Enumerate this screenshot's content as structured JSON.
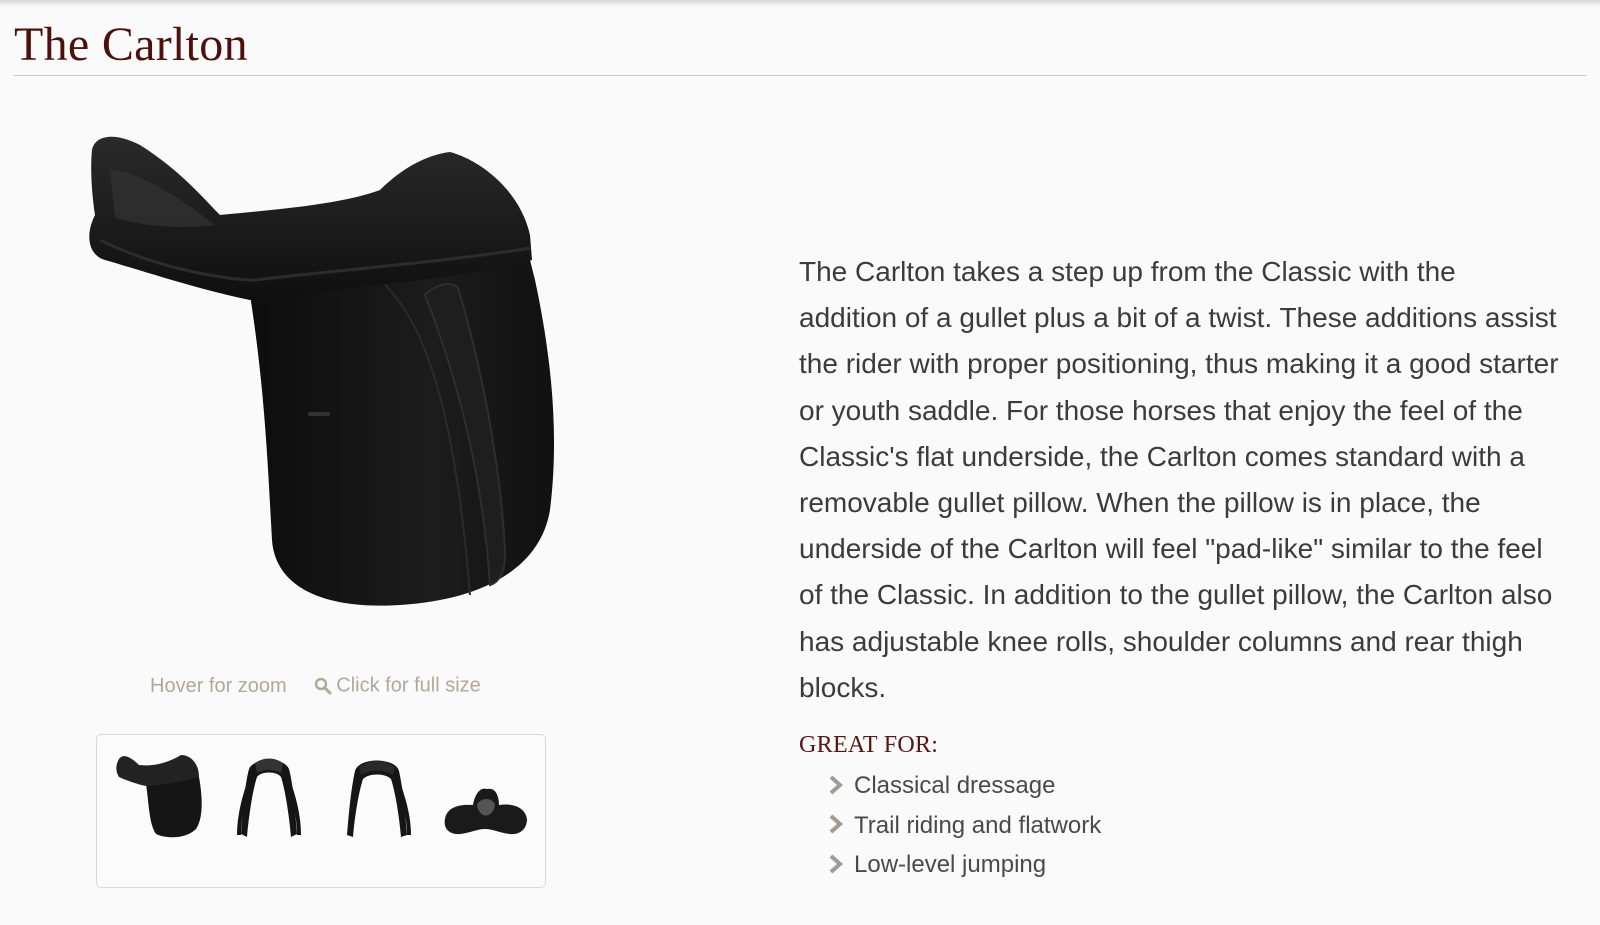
{
  "page": {
    "title": "The Carlton"
  },
  "gallery": {
    "hover_hint": "Hover for zoom",
    "full_size_label": "Click for full size",
    "thumbnails": [
      {
        "icon": "saddle-side-view"
      },
      {
        "icon": "saddle-front-view"
      },
      {
        "icon": "saddle-rear-view"
      },
      {
        "icon": "saddle-underside-view"
      }
    ]
  },
  "description": " The Carlton takes a step up from the Classic with the addition of a gullet plus a bit of a twist. These additions assist the rider with proper positioning, thus making it a good starter or youth saddle. For those horses that enjoy the feel of the Classic's flat underside, the Carlton comes standard with a removable gullet pillow. When the pillow is in place, the underside of the Carlton will feel \"pad-like\" similar to the feel of the Classic. In addition to the gullet pillow, the Carlton also has adjustable knee rolls, shoulder columns and rear thigh blocks.",
  "great_for": {
    "heading": "GREAT FOR:",
    "items": [
      "Classical dressage",
      "Trail riding and flatwork",
      "Low-level jumping"
    ]
  },
  "colors": {
    "title": "#4f100c",
    "rule": "#d8c9b8",
    "hint_text": "#b3a898",
    "body_text": "#3b3b3b",
    "saddle_leather": "#151515",
    "chevron": "#a39b92"
  }
}
